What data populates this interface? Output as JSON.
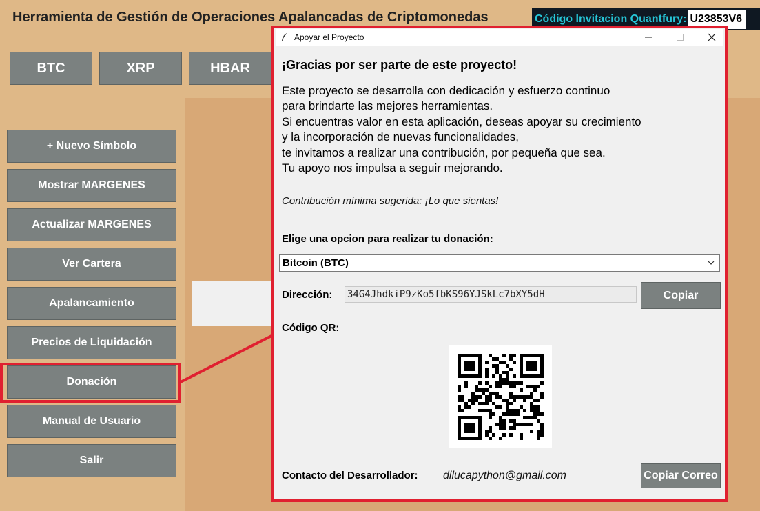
{
  "app": {
    "title": "Herramienta de Gestión de Operaciones Apalancadas de Criptomonedas",
    "invite_label": "Código Invitacion Quantfury:",
    "invite_code": "U23853V6"
  },
  "coin_tabs": [
    "BTC",
    "XRP",
    "HBAR"
  ],
  "sidebar": {
    "items": [
      {
        "label": "+ Nuevo Símbolo"
      },
      {
        "label": "Mostrar MARGENES"
      },
      {
        "label": "Actualizar MARGENES"
      },
      {
        "label": "Ver Cartera"
      },
      {
        "label": "Apalancamiento"
      },
      {
        "label": "Precios de Liquidación"
      },
      {
        "label": "Donación"
      },
      {
        "label": "Manual de Usuario"
      },
      {
        "label": "Salir"
      }
    ]
  },
  "dialog": {
    "title": "Apoyar el Proyecto",
    "heading": "¡Gracias por ser parte de este proyecto!",
    "body_lines": [
      "Este proyecto se desarrolla con dedicación y esfuerzo continuo",
      "para brindarte las mejores herramientas.",
      "Si encuentras valor en esta aplicación, deseas apoyar su crecimiento",
      "y la incorporación de nuevas funcionalidades,",
      "te invitamos a realizar una contribución, por pequeña que sea.",
      "Tu apoyo nos impulsa a seguir mejorando."
    ],
    "min_contribution": "Contribución mínima sugerida: ¡Lo que sientas!",
    "choose_label": "Elige una opcion para realizar tu donación:",
    "selected_option": "Bitcoin (BTC)",
    "address_label": "Dirección:",
    "address_value": "34G4JhdkiP9zKo5fbKS96YJSkLc7bXY5dH",
    "copy_button": "Copiar",
    "qr_label": "Código QR:",
    "contact_label": "Contacto del Desarrollador:",
    "contact_email": "dilucapython@gmail.com",
    "copy_email_button": "Copiar Correo"
  },
  "colors": {
    "background": "#dfb887",
    "button_gray": "#7b8180",
    "highlight_red": "#e02030",
    "invite_cyan": "#26c6d8"
  },
  "icons": [
    "feather-icon",
    "minimize-icon",
    "maximize-icon",
    "close-icon",
    "chevron-down-icon",
    "qr-code"
  ]
}
